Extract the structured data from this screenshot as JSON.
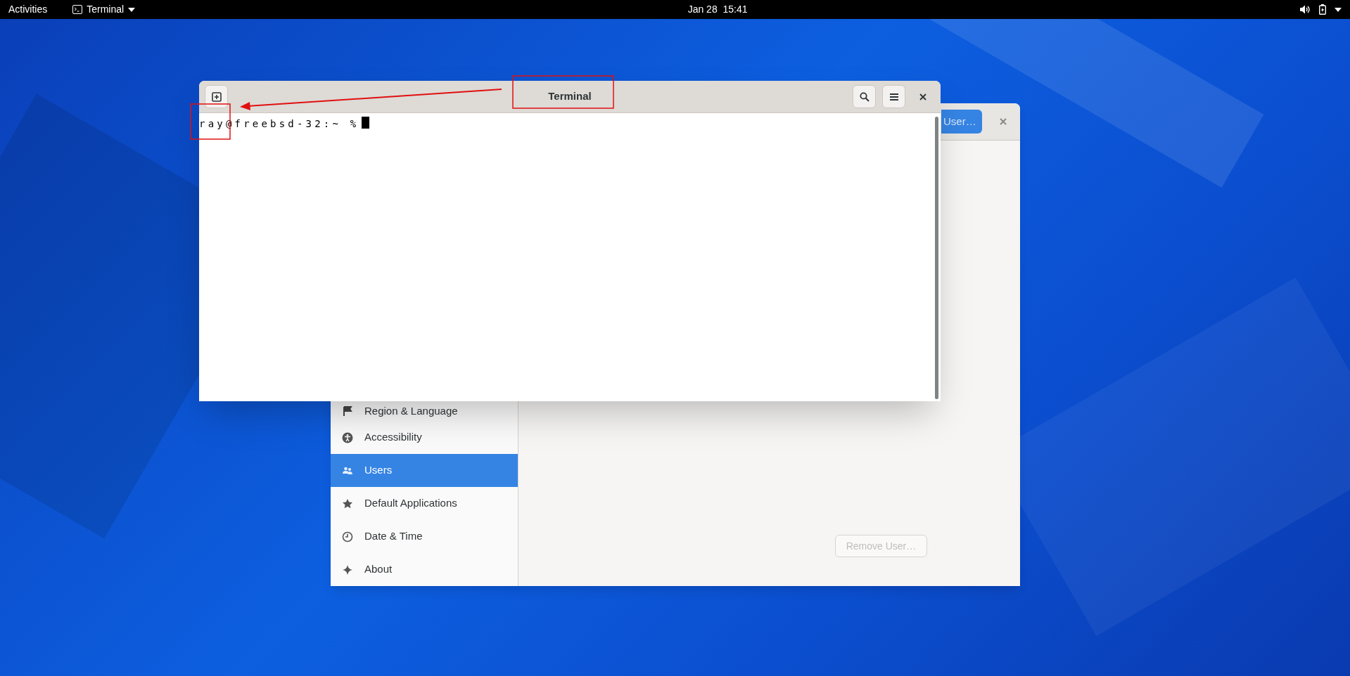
{
  "top_bar": {
    "activities": "Activities",
    "app_menu": "Terminal",
    "clock": "Jan 28  15:41"
  },
  "settings_window": {
    "header_button": "User…",
    "sidebar": {
      "items": [
        {
          "label": "Region & Language",
          "kind": "flag",
          "selected": false
        },
        {
          "label": "Accessibility",
          "kind": "accessibility",
          "selected": false
        },
        {
          "label": "Users",
          "kind": "users",
          "selected": true
        },
        {
          "label": "Default Applications",
          "kind": "star",
          "selected": false
        },
        {
          "label": "Date & Time",
          "kind": "clock",
          "selected": false
        },
        {
          "label": "About",
          "kind": "sparkle",
          "selected": false
        }
      ]
    },
    "remove_button": {
      "label": "Remove User…",
      "disabled": true
    }
  },
  "terminal_window": {
    "title": "Terminal",
    "prompt": "ray@freebsd-32:~ %"
  }
}
